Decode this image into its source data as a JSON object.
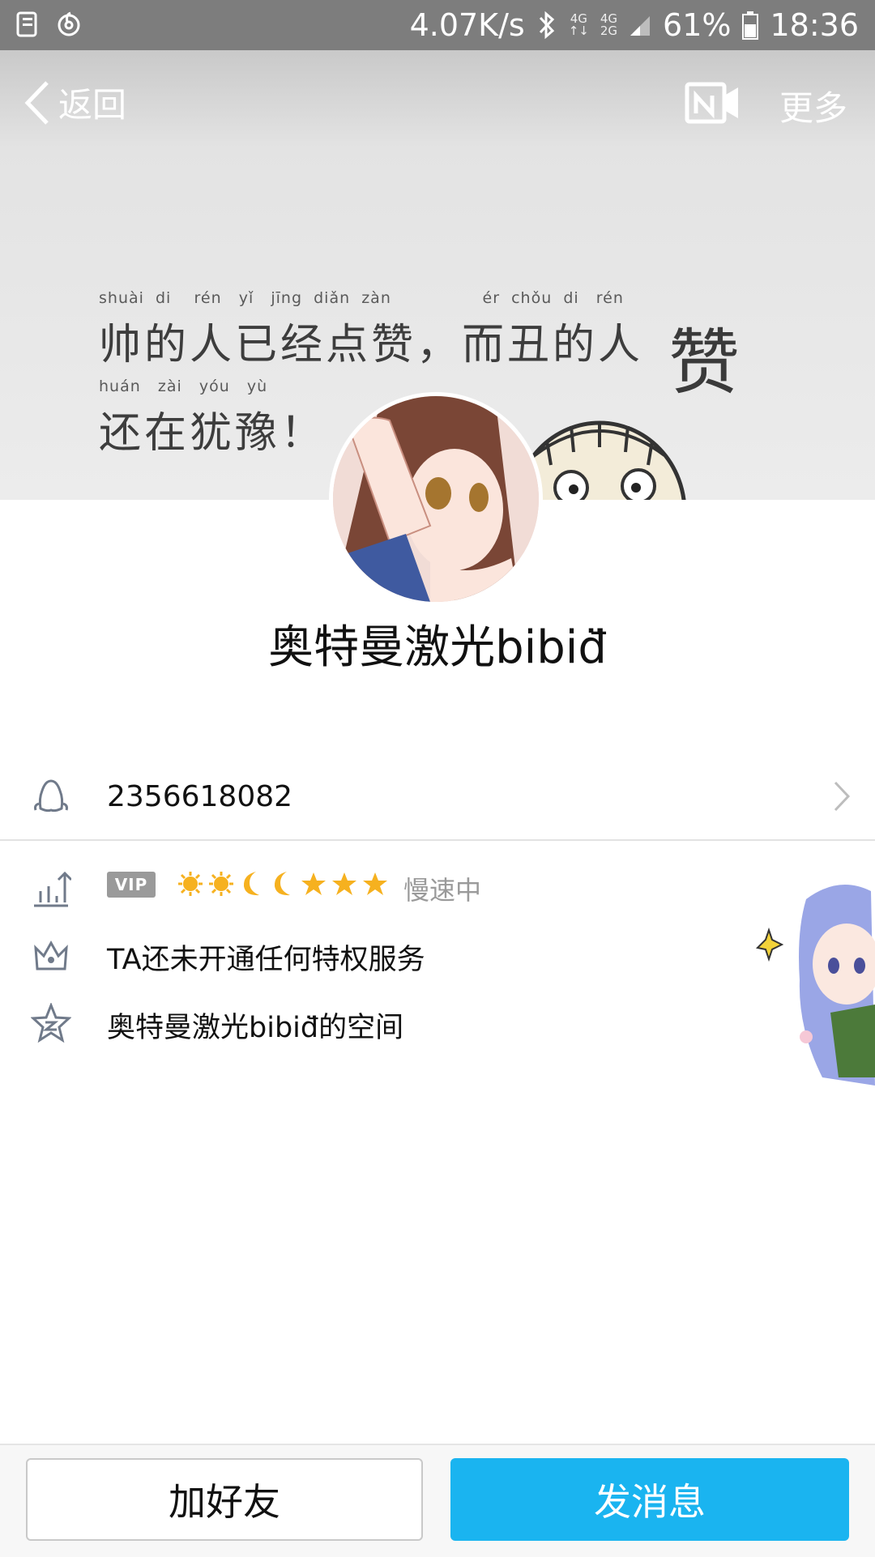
{
  "status_bar": {
    "speed": "4.07K/s",
    "net_top": "4G",
    "net_mid": "4G",
    "net_bottom": "2G",
    "battery": "61%",
    "time": "18:36"
  },
  "nav": {
    "back_label": "返回",
    "more_label": "更多"
  },
  "cover": {
    "pinyin_line1": "shuài  di    rén   yǐ   jīng  diǎn  zàn                ér  chǒu  di   rén",
    "text_line1": "帅的人已经点赞，而丑的人",
    "pinyin_line2": "huán   zài   yóu   yù",
    "text_line2": "还在犹豫！",
    "big_char": "赞"
  },
  "profile": {
    "nickname": "奥特曼激光bibiđ̈"
  },
  "qq": {
    "number": "2356618082"
  },
  "level": {
    "vip": "VIP",
    "icons": [
      "sun",
      "sun",
      "moon",
      "moon",
      "star",
      "star",
      "star"
    ],
    "speed_text": "慢速中"
  },
  "privilege": {
    "text": "TA还未开通任何特权服务"
  },
  "space": {
    "text": "奥特曼激光bibiđ̈的空间"
  },
  "actions": {
    "add_friend": "加好友",
    "send_message": "发消息"
  },
  "colors": {
    "accent": "#1ab4f0",
    "status_bar": "#7d7d7d"
  }
}
